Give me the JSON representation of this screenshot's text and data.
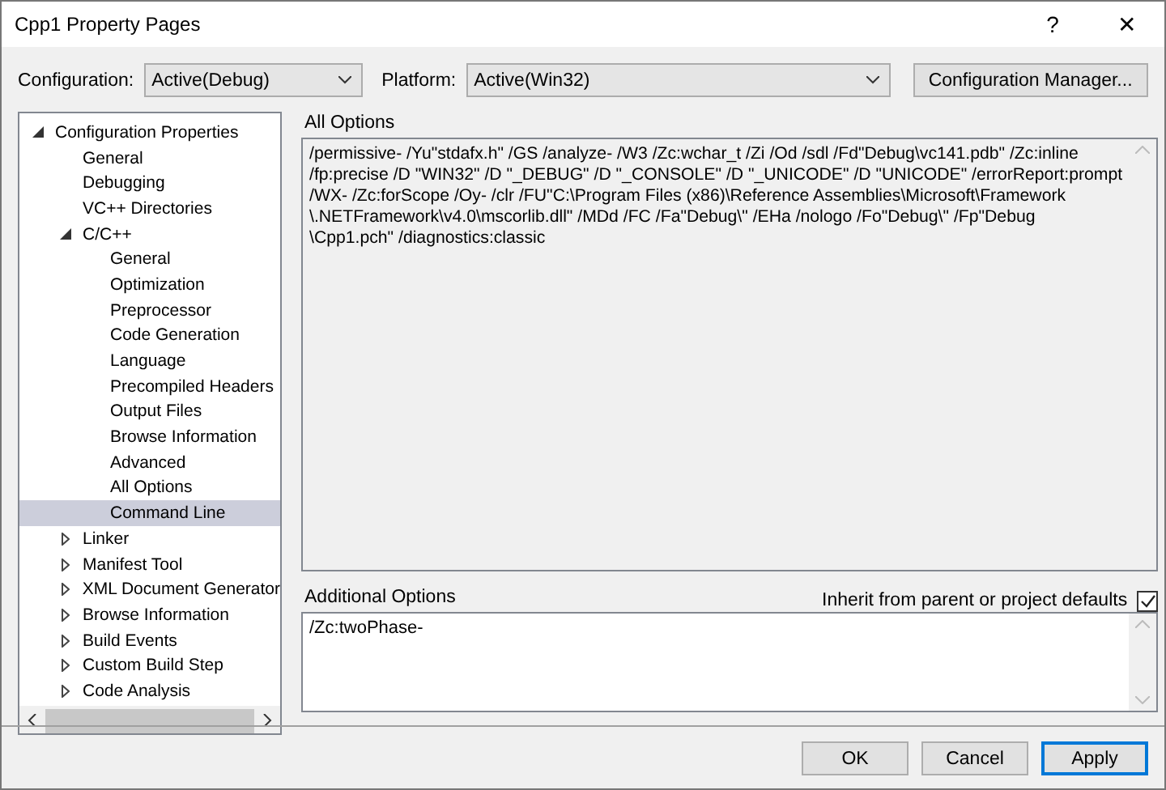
{
  "window": {
    "title": "Cpp1 Property Pages",
    "help": "?",
    "close": "✕"
  },
  "toolbar": {
    "configuration_label": "Configuration:",
    "configuration": "Active(Debug)",
    "platform_label": "Platform:",
    "platform": "Active(Win32)",
    "manager_button": "Configuration Manager..."
  },
  "tree": [
    {
      "label": "Configuration Properties",
      "expanded": true,
      "selected": false,
      "children": [
        {
          "label": "General",
          "selected": false
        },
        {
          "label": "Debugging",
          "selected": false
        },
        {
          "label": "VC++ Directories",
          "selected": false
        },
        {
          "label": "C/C++",
          "expanded": true,
          "selected": false,
          "children": [
            {
              "label": "General",
              "selected": false
            },
            {
              "label": "Optimization",
              "selected": false
            },
            {
              "label": "Preprocessor",
              "selected": false
            },
            {
              "label": "Code Generation",
              "selected": false
            },
            {
              "label": "Language",
              "selected": false
            },
            {
              "label": "Precompiled Headers",
              "selected": false
            },
            {
              "label": "Output Files",
              "selected": false
            },
            {
              "label": "Browse Information",
              "selected": false
            },
            {
              "label": "Advanced",
              "selected": false
            },
            {
              "label": "All Options",
              "selected": false
            },
            {
              "label": "Command Line",
              "selected": true
            }
          ]
        },
        {
          "label": "Linker",
          "expanded": false,
          "selected": false
        },
        {
          "label": "Manifest Tool",
          "expanded": false,
          "selected": false
        },
        {
          "label": "XML Document Generator",
          "expanded": false,
          "selected": false
        },
        {
          "label": "Browse Information",
          "expanded": false,
          "selected": false
        },
        {
          "label": "Build Events",
          "expanded": false,
          "selected": false
        },
        {
          "label": "Custom Build Step",
          "expanded": false,
          "selected": false
        },
        {
          "label": "Code Analysis",
          "expanded": false,
          "selected": false
        }
      ]
    }
  ],
  "all_options": {
    "label": "All Options",
    "lines": [
      "/permissive- /Yu\"stdafx.h\" /GS /analyze- /W3 /Zc:wchar_t /Zi /Od /sdl /Fd\"Debug\\vc141.pdb\" /Zc:inline",
      "/fp:precise /D \"WIN32\" /D \"_DEBUG\" /D \"_CONSOLE\" /D \"_UNICODE\" /D \"UNICODE\" /errorReport:prompt",
      "/WX- /Zc:forScope /Oy- /clr /FU\"C:\\Program Files (x86)\\Reference Assemblies\\Microsoft\\Framework",
      "\\.NETFramework\\v4.0\\mscorlib.dll\" /MDd /FC /Fa\"Debug\\\" /EHa /nologo /Fo\"Debug\\\" /Fp\"Debug",
      "\\Cpp1.pch\" /diagnostics:classic"
    ]
  },
  "additional_options": {
    "label": "Additional Options",
    "value": "/Zc:twoPhase-",
    "inherit_label": "Inherit from parent or project defaults",
    "inherit_checked": true
  },
  "buttons": [
    {
      "label": "OK",
      "default": false
    },
    {
      "label": "Cancel",
      "default": false
    },
    {
      "label": "Apply",
      "default": true
    }
  ]
}
